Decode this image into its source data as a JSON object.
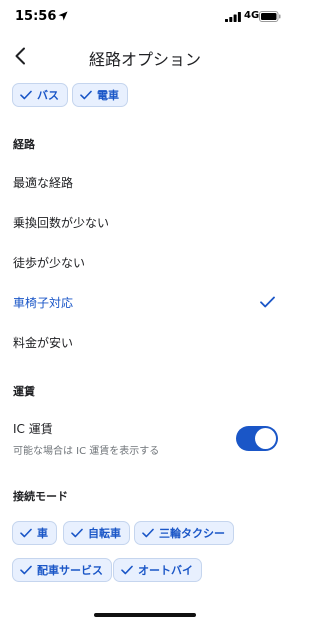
{
  "status_bar": {
    "time": "15:56",
    "network": "4G"
  },
  "nav": {
    "title": "経路オプション"
  },
  "transit_modes": [
    {
      "label": "バス",
      "checked": true
    },
    {
      "label": "電車",
      "checked": true
    }
  ],
  "route": {
    "title": "経路",
    "options": [
      {
        "label": "最適な経路",
        "selected": false
      },
      {
        "label": "乗換回数が少ない",
        "selected": false
      },
      {
        "label": "徒歩が少ない",
        "selected": false
      },
      {
        "label": "車椅子対応",
        "selected": true
      },
      {
        "label": "料金が安い",
        "selected": false
      }
    ]
  },
  "fare": {
    "title": "運賃",
    "ic_title": "IC 運賃",
    "ic_subtitle": "可能な場合は IC 運賃を表示する",
    "ic_enabled": true
  },
  "connection": {
    "title": "接続モード",
    "chips": [
      {
        "label": "車",
        "checked": true
      },
      {
        "label": "自転車",
        "checked": true
      },
      {
        "label": "三輪タクシー",
        "checked": true
      },
      {
        "label": "配車サービス",
        "checked": true
      },
      {
        "label": "オートバイ",
        "checked": true
      }
    ]
  },
  "colors": {
    "accent": "#1a56c7",
    "chip_bg": "#e8f0fe",
    "text": "#202124",
    "secondary_text": "#70757a"
  }
}
